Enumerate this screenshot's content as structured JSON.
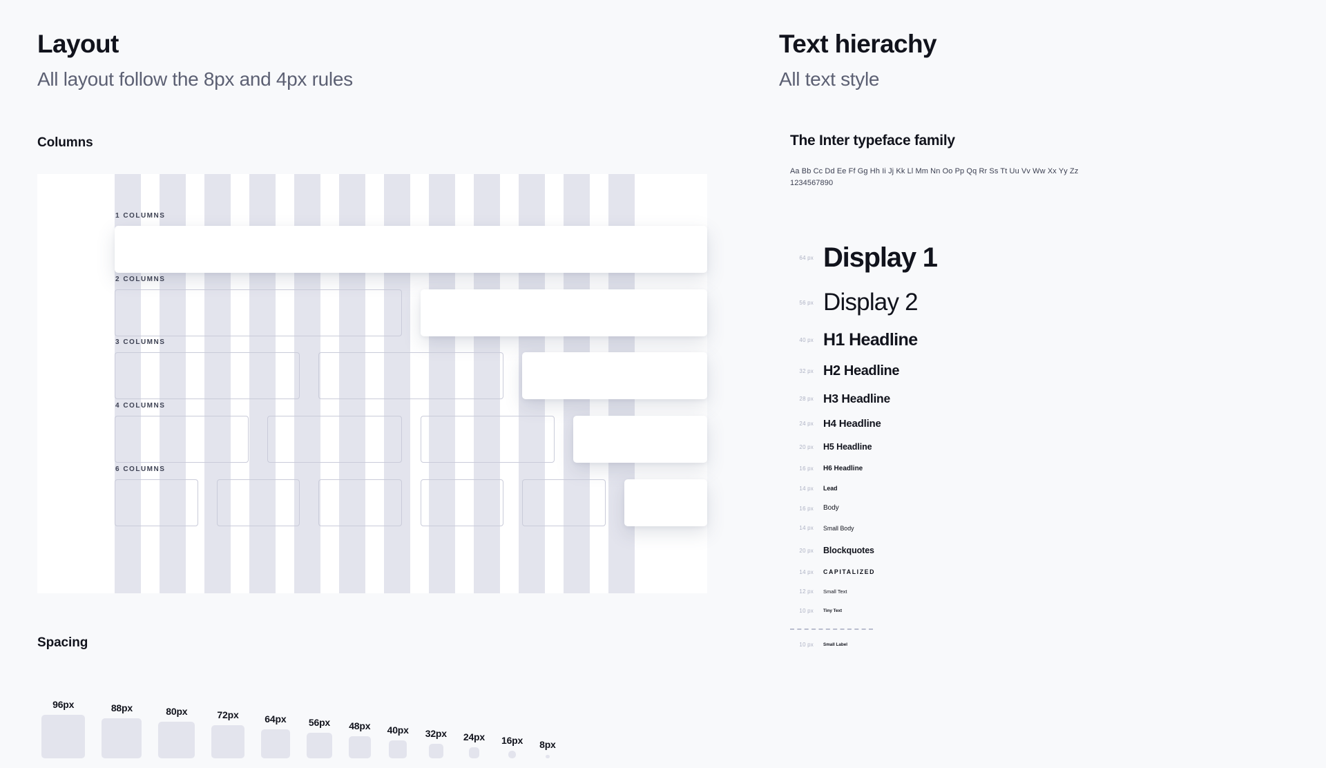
{
  "theme": {
    "background": "#f8f9fb",
    "text_primary": "#11131c",
    "text_secondary": "#5c6073",
    "swatch": "#e3e4ed",
    "card": "#ffffff",
    "cell_border": "#c9cbd9",
    "size_label": "#aeb2c4"
  },
  "layout_panel": {
    "title": "Layout",
    "subtitle": "All layout follow the 8px and 4px rules",
    "columns": {
      "heading": "Columns",
      "stripe_count": 12,
      "rows": [
        {
          "label": "1 COLUMNS",
          "cells": 1
        },
        {
          "label": "2 COLUMNS",
          "cells": 2
        },
        {
          "label": "3 COLUMNS",
          "cells": 3
        },
        {
          "label": "4 COLUMNS",
          "cells": 4
        },
        {
          "label": "6 COLUMNS",
          "cells": 6
        }
      ]
    },
    "spacing": {
      "heading": "Spacing",
      "items": [
        {
          "label": "96px",
          "size": 96
        },
        {
          "label": "88px",
          "size": 88
        },
        {
          "label": "80px",
          "size": 80
        },
        {
          "label": "72px",
          "size": 72
        },
        {
          "label": "64px",
          "size": 64
        },
        {
          "label": "56px",
          "size": 56
        },
        {
          "label": "48px",
          "size": 48
        },
        {
          "label": "40px",
          "size": 40
        },
        {
          "label": "32px",
          "size": 32
        },
        {
          "label": "24px",
          "size": 24
        },
        {
          "label": "16px",
          "size": 16
        },
        {
          "label": "8px",
          "size": 8
        }
      ]
    }
  },
  "text_panel": {
    "title": "Text hierachy",
    "subtitle": "All text style",
    "typeface_name": "The Inter typeface family",
    "specimen_alphabet": "Aa Bb Cc Dd Ee Ff Gg Hh Ii Jj Kk Ll Mm Nn Oo Pp Qq Rr Ss Tt Uu Vv Ww Xx Yy Zz",
    "specimen_numerals": "1234567890",
    "scale": [
      {
        "size": "64 px",
        "name": "Display 1",
        "style": "t-display1",
        "gap": 30
      },
      {
        "size": "56 px",
        "name": "Display 2",
        "style": "t-display2",
        "gap": 22
      },
      {
        "size": "40 px",
        "name": "H1 Headline",
        "style": "t-h1",
        "gap": 20
      },
      {
        "size": "32 px",
        "name": "H2 Headline",
        "style": "t-h2",
        "gap": 19
      },
      {
        "size": "28 px",
        "name": "H3 Headline",
        "style": "t-h3",
        "gap": 18
      },
      {
        "size": "24 px",
        "name": "H4 Headline",
        "style": "t-h4",
        "gap": 18
      },
      {
        "size": "20 px",
        "name": "H5 Headline",
        "style": "t-h5",
        "gap": 18
      },
      {
        "size": "16 px",
        "name": "H6 Headline",
        "style": "t-h6",
        "gap": 18
      },
      {
        "size": "14 px",
        "name": "Lead",
        "style": "t-lead",
        "gap": 18
      },
      {
        "size": "16 px",
        "name": "Body",
        "style": "t-body",
        "gap": 18
      },
      {
        "size": "14 px",
        "name": "Small Body",
        "style": "t-smallbody",
        "gap": 18
      },
      {
        "size": "20 px",
        "name": "Blockquotes",
        "style": "t-blockquote",
        "gap": 20
      },
      {
        "size": "14 px",
        "name": "CAPITALIZED",
        "style": "t-capitalized",
        "gap": 19
      },
      {
        "size": "12 px",
        "name": "Small Text",
        "style": "t-smalltext",
        "gap": 19
      },
      {
        "size": "10 px",
        "name": "Tiny Text",
        "style": "t-tinytext",
        "gap": 19
      }
    ],
    "divider": {
      "gap": 21
    },
    "trailing": [
      {
        "size": "10 px",
        "name": "Small Label",
        "style": "t-smalllabel",
        "gap": 17
      }
    ]
  }
}
